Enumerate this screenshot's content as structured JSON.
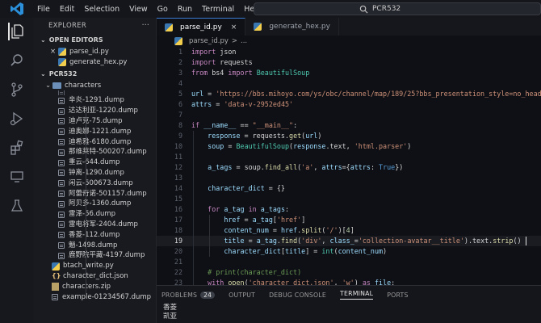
{
  "menu": [
    "File",
    "Edit",
    "Selection",
    "View",
    "Go",
    "Run",
    "Terminal",
    "Help"
  ],
  "search": {
    "text": "PCR532"
  },
  "explorer": {
    "title": "EXPLORER",
    "open_editors_label": "OPEN EDITORS",
    "open_editors": [
      {
        "name": "parse_id.py",
        "prefix": "×"
      },
      {
        "name": "generate_hex.py",
        "prefix": ""
      }
    ],
    "project_label": "PCR532",
    "folder_label": "characters",
    "files": [
      "辛炎-1291.dump",
      "达达利亚-1220.dump",
      "迪卢克-75.dump",
      "迪奥娜-1221.dump",
      "迪希雅-6180.dump",
      "那维莱特-500207.dump",
      "重云-644.dump",
      "钟离-1290.dump",
      "闲云-500673.dump",
      "阿蕾奇诺-501157.dump",
      "阿贝多-1360.dump",
      "雷泽-56.dump",
      "雷电将军-2404.dump",
      "香菱-112.dump",
      "魈-1498.dump",
      "鹿野院平藏-4197.dump"
    ],
    "root_files": [
      {
        "name": "btach_write.py",
        "type": "py"
      },
      {
        "name": "character_dict.json",
        "type": "json"
      },
      {
        "name": "characters.zip",
        "type": "zip"
      },
      {
        "name": "example-01234567.dump",
        "type": "dump"
      }
    ]
  },
  "tabs": [
    {
      "label": "parse_id.py",
      "close": "×"
    },
    {
      "label": "generate_hex.py"
    }
  ],
  "breadcrumb": {
    "file": "parse_id.py",
    "sep": ">",
    "rest": "..."
  },
  "code": {
    "line_numbers": [
      "1",
      "2",
      "3",
      "4",
      "5",
      "6",
      "7",
      "8",
      "9",
      "10",
      "11",
      "12",
      "13",
      "14",
      "15",
      "16",
      "17",
      "18",
      "19",
      "20",
      "21",
      "22",
      "23"
    ],
    "current_line": "19"
  },
  "panel": {
    "tabs": [
      "PROBLEMS",
      "OUTPUT",
      "DEBUG CONSOLE",
      "TERMINAL",
      "PORTS"
    ],
    "problems_count": "24",
    "active_tab": "TERMINAL",
    "output_lines": [
      "香菱",
      "凯亚"
    ]
  }
}
